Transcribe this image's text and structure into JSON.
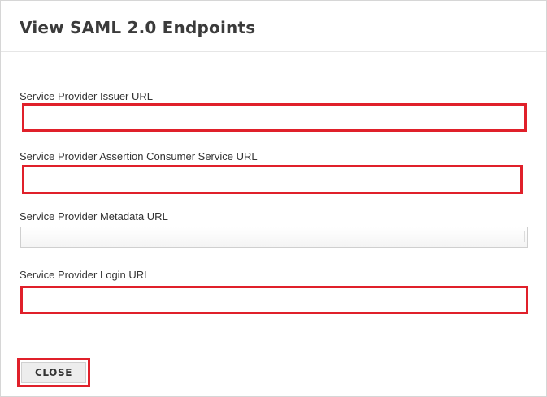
{
  "dialog": {
    "title": "View SAML 2.0 Endpoints"
  },
  "fields": [
    {
      "label": "Service Provider Issuer URL",
      "value": "",
      "highlighted": true
    },
    {
      "label": "Service Provider Assertion Consumer Service URL",
      "value": "",
      "highlighted": true
    },
    {
      "label": "Service Provider Metadata URL",
      "value": "",
      "highlighted": false
    },
    {
      "label": "Service Provider Login URL",
      "value": "",
      "highlighted": true
    }
  ],
  "footer": {
    "close_label": "CLOSE"
  },
  "colors": {
    "highlight": "#e0202a",
    "title_text": "#3b3b3b",
    "button_bg": "#ededed"
  }
}
